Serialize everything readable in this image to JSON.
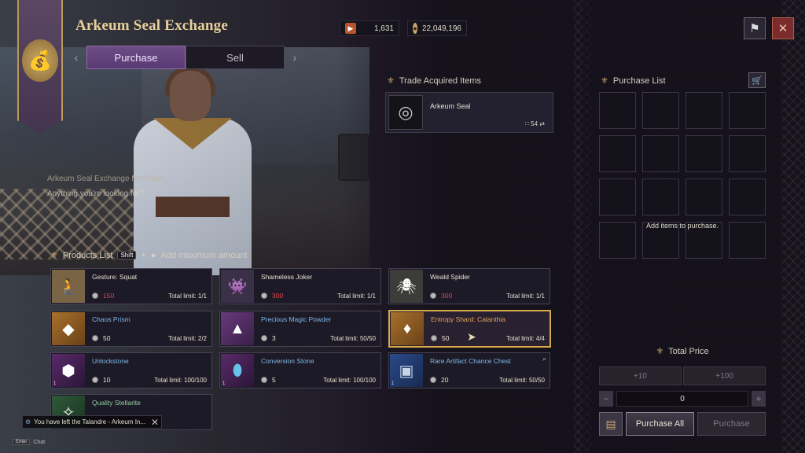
{
  "window": {
    "title": "Arkeum Seal Exchange",
    "tabs": [
      {
        "label": "Purchase",
        "active": true
      },
      {
        "label": "Sell",
        "active": false
      }
    ]
  },
  "currencies": [
    {
      "icon": "seal-currency-icon",
      "value": "1,631"
    },
    {
      "icon": "silver-coin-icon",
      "value": "22,049,196"
    }
  ],
  "npc": {
    "name": "Arkeum Seal Exchange Merchant",
    "line": "Anything you're looking for?"
  },
  "trade": {
    "heading": "Trade Acquired Items",
    "item": {
      "name": "Arkeum Seal",
      "count": "54"
    }
  },
  "products": {
    "heading": "Products List",
    "hint_key": "Shift",
    "hint_plus": "+",
    "hint_text": "Add maximum amount",
    "items": [
      {
        "name": "Gesture: Squat",
        "price": "150",
        "limit": "Total limit: 1/1",
        "insufficient": true,
        "name_color": "white",
        "icon": "gesture-icon"
      },
      {
        "name": "Shameless Joker",
        "price": "300",
        "limit": "Total limit: 1/1",
        "insufficient": true,
        "name_color": "white",
        "icon": "joker-icon"
      },
      {
        "name": "Weald Spider",
        "price": "300",
        "limit": "Total limit: 1/1",
        "insufficient": true,
        "name_color": "white",
        "icon": "spider-icon"
      },
      {
        "name": "Chaos Prism",
        "price": "50",
        "limit": "Total limit: 2/2",
        "insufficient": false,
        "name_color": "blue",
        "icon": "prism-icon"
      },
      {
        "name": "Precious Magic Powder",
        "price": "3",
        "limit": "Total limit: 50/50",
        "insufficient": false,
        "name_color": "blue",
        "icon": "powder-icon"
      },
      {
        "name": "Entropy Shard: Calanthia",
        "price": "50",
        "limit": "Total limit: 4/4",
        "insufficient": false,
        "name_color": "orange",
        "icon": "shard-icon",
        "selected": true
      },
      {
        "name": "Unlockstone",
        "price": "10",
        "limit": "Total limit: 100/100",
        "insufficient": false,
        "name_color": "blue",
        "icon": "unlockstone-icon",
        "badge": "1"
      },
      {
        "name": "Conversion Stone",
        "price": "5",
        "limit": "Total limit: 100/100",
        "insufficient": false,
        "name_color": "blue",
        "icon": "conversion-stone-icon",
        "badge": "1"
      },
      {
        "name": "Rare Artifact Chance Chest",
        "price": "20",
        "limit": "Total limit: 50/50",
        "insufficient": false,
        "name_color": "blue",
        "icon": "chest-icon",
        "badge": "1"
      },
      {
        "name": "Quality Stellarite",
        "price": "",
        "limit": "",
        "insufficient": false,
        "name_color": "green",
        "icon": "stellarite-icon"
      }
    ]
  },
  "purchase_list": {
    "heading": "Purchase List",
    "empty_text": "Add items to purchase."
  },
  "total": {
    "heading": "Total Price",
    "step1": "+10",
    "step2": "+100",
    "minus": "−",
    "plus": "+",
    "quantity": "0",
    "purchase_all": "Purchase All",
    "purchase": "Purchase"
  },
  "notification": {
    "text": "You have left the Talandre - Arkeum In..."
  },
  "chat": {
    "key": "Enter",
    "label": "Chat"
  },
  "colors": {
    "accent_gold": "#e8cf9a",
    "tab_active": "#6e4c86",
    "price_red": "#e5484d",
    "selected_border": "#d6a94a"
  }
}
